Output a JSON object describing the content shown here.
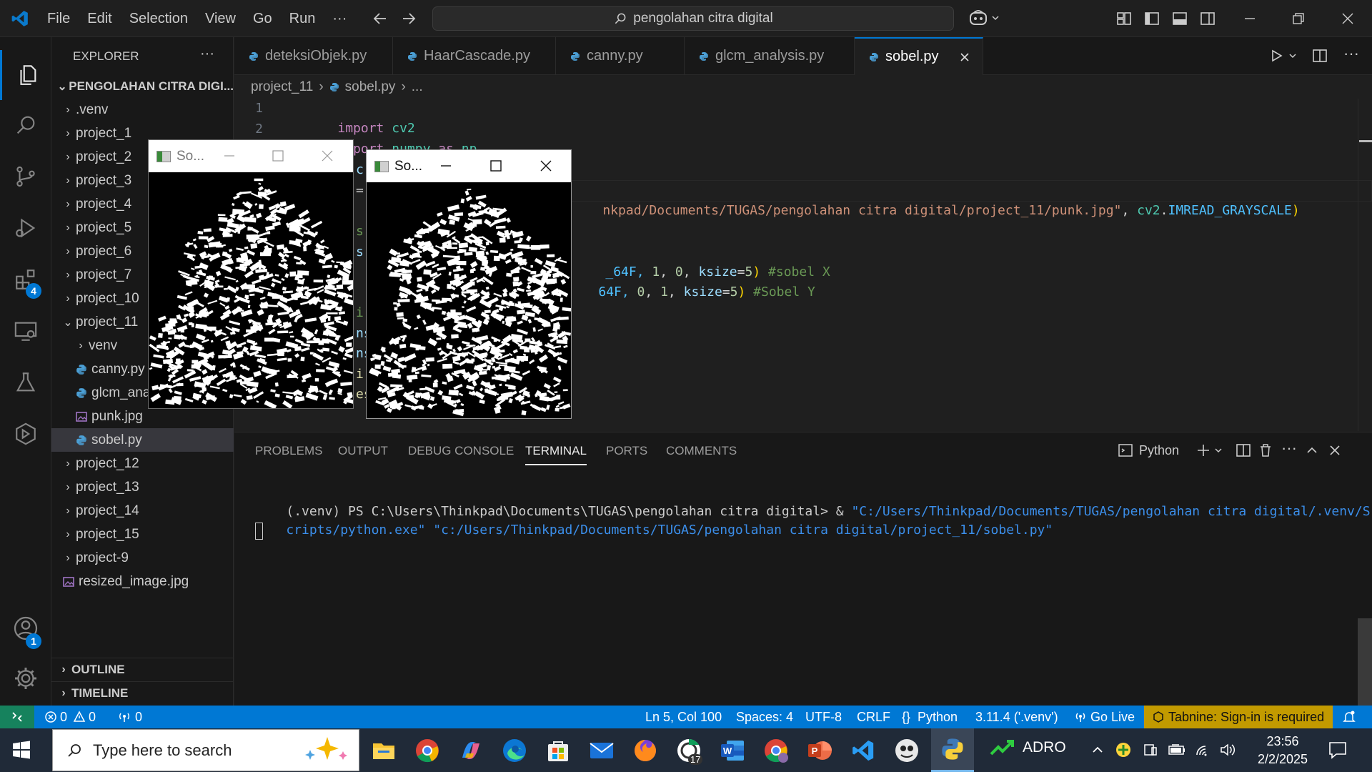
{
  "titlebar": {
    "menu": [
      "File",
      "Edit",
      "Selection",
      "View",
      "Go",
      "Run",
      "···"
    ],
    "search": "pengolahan citra digital"
  },
  "activity": {
    "extensions_badge": "4",
    "accounts_badge": "1"
  },
  "sidebar": {
    "header": "EXPLORER",
    "more": "···",
    "root": "PENGOLAHAN CITRA DIGI...",
    "items": [
      {
        "label": ".venv",
        "kind": "folder",
        "state": "collapsed",
        "depth": 1
      },
      {
        "label": "project_1",
        "kind": "folder",
        "state": "collapsed",
        "depth": 1
      },
      {
        "label": "project_2",
        "kind": "folder",
        "state": "collapsed",
        "depth": 1
      },
      {
        "label": "project_3",
        "kind": "folder",
        "state": "collapsed",
        "depth": 1
      },
      {
        "label": "project_4",
        "kind": "folder",
        "state": "collapsed",
        "depth": 1
      },
      {
        "label": "project_5",
        "kind": "folder",
        "state": "collapsed",
        "depth": 1
      },
      {
        "label": "project_6",
        "kind": "folder",
        "state": "collapsed",
        "depth": 1
      },
      {
        "label": "project_7",
        "kind": "folder",
        "state": "collapsed",
        "depth": 1
      },
      {
        "label": "project_10",
        "kind": "folder",
        "state": "collapsed",
        "depth": 1
      },
      {
        "label": "project_11",
        "kind": "folder",
        "state": "expanded",
        "depth": 1
      },
      {
        "label": "venv",
        "kind": "folder",
        "state": "collapsed",
        "depth": 2
      },
      {
        "label": "canny.py",
        "kind": "python",
        "depth": 2
      },
      {
        "label": "glcm_analysis.py",
        "kind": "python",
        "depth": 2
      },
      {
        "label": "punk.jpg",
        "kind": "image",
        "depth": 2
      },
      {
        "label": "sobel.py",
        "kind": "python",
        "depth": 2,
        "selected": true
      },
      {
        "label": "project_12",
        "kind": "folder",
        "state": "collapsed",
        "depth": 1
      },
      {
        "label": "project_13",
        "kind": "folder",
        "state": "collapsed",
        "depth": 1
      },
      {
        "label": "project_14",
        "kind": "folder",
        "state": "collapsed",
        "depth": 1
      },
      {
        "label": "project_15",
        "kind": "folder",
        "state": "collapsed",
        "depth": 1
      },
      {
        "label": "project-9",
        "kind": "folder",
        "state": "collapsed",
        "depth": 1
      },
      {
        "label": "resized_image.jpg",
        "kind": "image",
        "depth": 1
      }
    ],
    "outline": "OUTLINE",
    "timeline": "TIMELINE"
  },
  "tabs": [
    {
      "label": "deteksiObjek.py"
    },
    {
      "label": "HaarCascade.py"
    },
    {
      "label": "canny.py"
    },
    {
      "label": "glcm_analysis.py"
    },
    {
      "label": "sobel.py",
      "active": true
    }
  ],
  "breadcrumb": {
    "folder": "project_11",
    "file": "sobel.py",
    "rest": "..."
  },
  "editor": {
    "line_numbers": [
      "1",
      "2"
    ],
    "line1": {
      "kw": "import",
      "mod": "cv2"
    },
    "line2": {
      "kw": "import",
      "mod": "numpy",
      "as": "as",
      "alias": "np"
    },
    "path_line": {
      "str": "nkpad/Documents/TUGAS/pengolahan citra digital/project_11/punk.jpg\"",
      "sep": ", ",
      "obj": "cv2",
      "dot": ".",
      "const": "IMREAD_GRAYSCALE",
      "close": ")"
    },
    "sobelx_line": {
      "a": "_64F, ",
      "b": "1",
      ",": ", ",
      "c": "0",
      ",2": ", ",
      "k": "ksize",
      "eq": "=",
      "v": "5",
      "cl": ")",
      "cm": "#sobel X"
    },
    "sobely_line": {
      "a": "64F, ",
      "b": "0",
      ",": ", ",
      "c": "1",
      ",2": ", ",
      "k": "ksize",
      "eq": "=",
      "v": "5",
      "cl": ")",
      "cm": "#Sobel Y"
    },
    "fragments": [
      "c",
      "=",
      "s",
      "s",
      "i",
      "nsl",
      "nsl",
      "i",
      "es"
    ]
  },
  "windows": [
    {
      "title": "So...",
      "name": "sobel-window-1"
    },
    {
      "title": "So...",
      "name": "sobel-window-2"
    }
  ],
  "panel": {
    "tabs": [
      "PROBLEMS",
      "OUTPUT",
      "DEBUG CONSOLE",
      "TERMINAL",
      "PORTS",
      "COMMENTS"
    ],
    "active_tab": "TERMINAL",
    "terminal_profile": "Python",
    "terminal_line1_prompt": "(.venv) PS C:\\Users\\Thinkpad\\Documents\\TUGAS\\pengolahan citra digital> & ",
    "terminal_line1_str": "\"C:/Users/Thinkpad/Documents/TUGAS/pengolahan citra digital/.venv/S",
    "terminal_line2_str": "cripts/python.exe\" \"c:/Users/Thinkpad/Documents/TUGAS/pengolahan citra digital/project_11/sobel.py\""
  },
  "statusbar": {
    "errors": "0",
    "warnings": "0",
    "ports": "0",
    "position": "Ln 5, Col 100",
    "spaces": "Spaces: 4",
    "encoding": "UTF-8",
    "eol": "CRLF",
    "language": "Python",
    "interpreter": "3.11.4 ('.venv')",
    "golive": "Go Live",
    "tabnine": "Tabnine: Sign-in is required"
  },
  "taskbar": {
    "search_placeholder": "Type here to search",
    "stock": "ADRO",
    "time": "23:56",
    "date": "2/2/2025",
    "chrome_badge": "17"
  },
  "colors": {
    "accent": "#0078d4",
    "statusbar": "#0078d4",
    "editor_bg": "#1f1f1f",
    "sidebar_bg": "#181818",
    "taskbar": "#202a38"
  }
}
